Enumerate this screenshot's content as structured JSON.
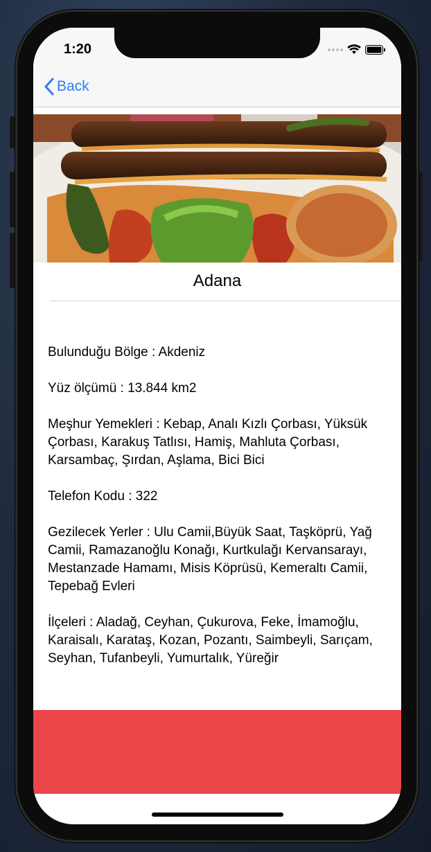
{
  "status_bar": {
    "time": "1:20"
  },
  "nav": {
    "back_label": "Back"
  },
  "hero": {
    "image_description_icon": "kebab-photo"
  },
  "city": {
    "name": "Adana"
  },
  "details": {
    "region": "Bulunduğu Bölge : Akdeniz",
    "area": "Yüz ölçümü : 13.844 km2",
    "dishes": "Meşhur Yemekleri : Kebap, Analı Kızlı Çorbası, Yüksük Çorbası, Karakuş Tatlısı, Hamiş, Mahluta Çorbası, Karsambaç, Şırdan, Aşlama, Bici Bici",
    "phone_code": "Telefon Kodu : 322",
    "places": "Gezilecek Yerler : Ulu Camii,Büyük Saat, Taşköprü, Yağ Camii, Ramazanoğlu Konağı, Kurtkulağı Kervansarayı, Mestanzade Hamamı, Misis Köprüsü, Kemeraltı Camii, Tepebağ Evleri",
    "districts": "İlçeleri : Aladağ, Ceyhan, Çukurova, Feke, İmamoğlu, Karaisalı, Karataş, Kozan, Pozantı, Saimbeyli, Sarıçam, Seyhan, Tufanbeyli, Yumurtalık, Yüreğir"
  },
  "colors": {
    "accent": "#2e7cf6",
    "banner": "#eb4649"
  }
}
